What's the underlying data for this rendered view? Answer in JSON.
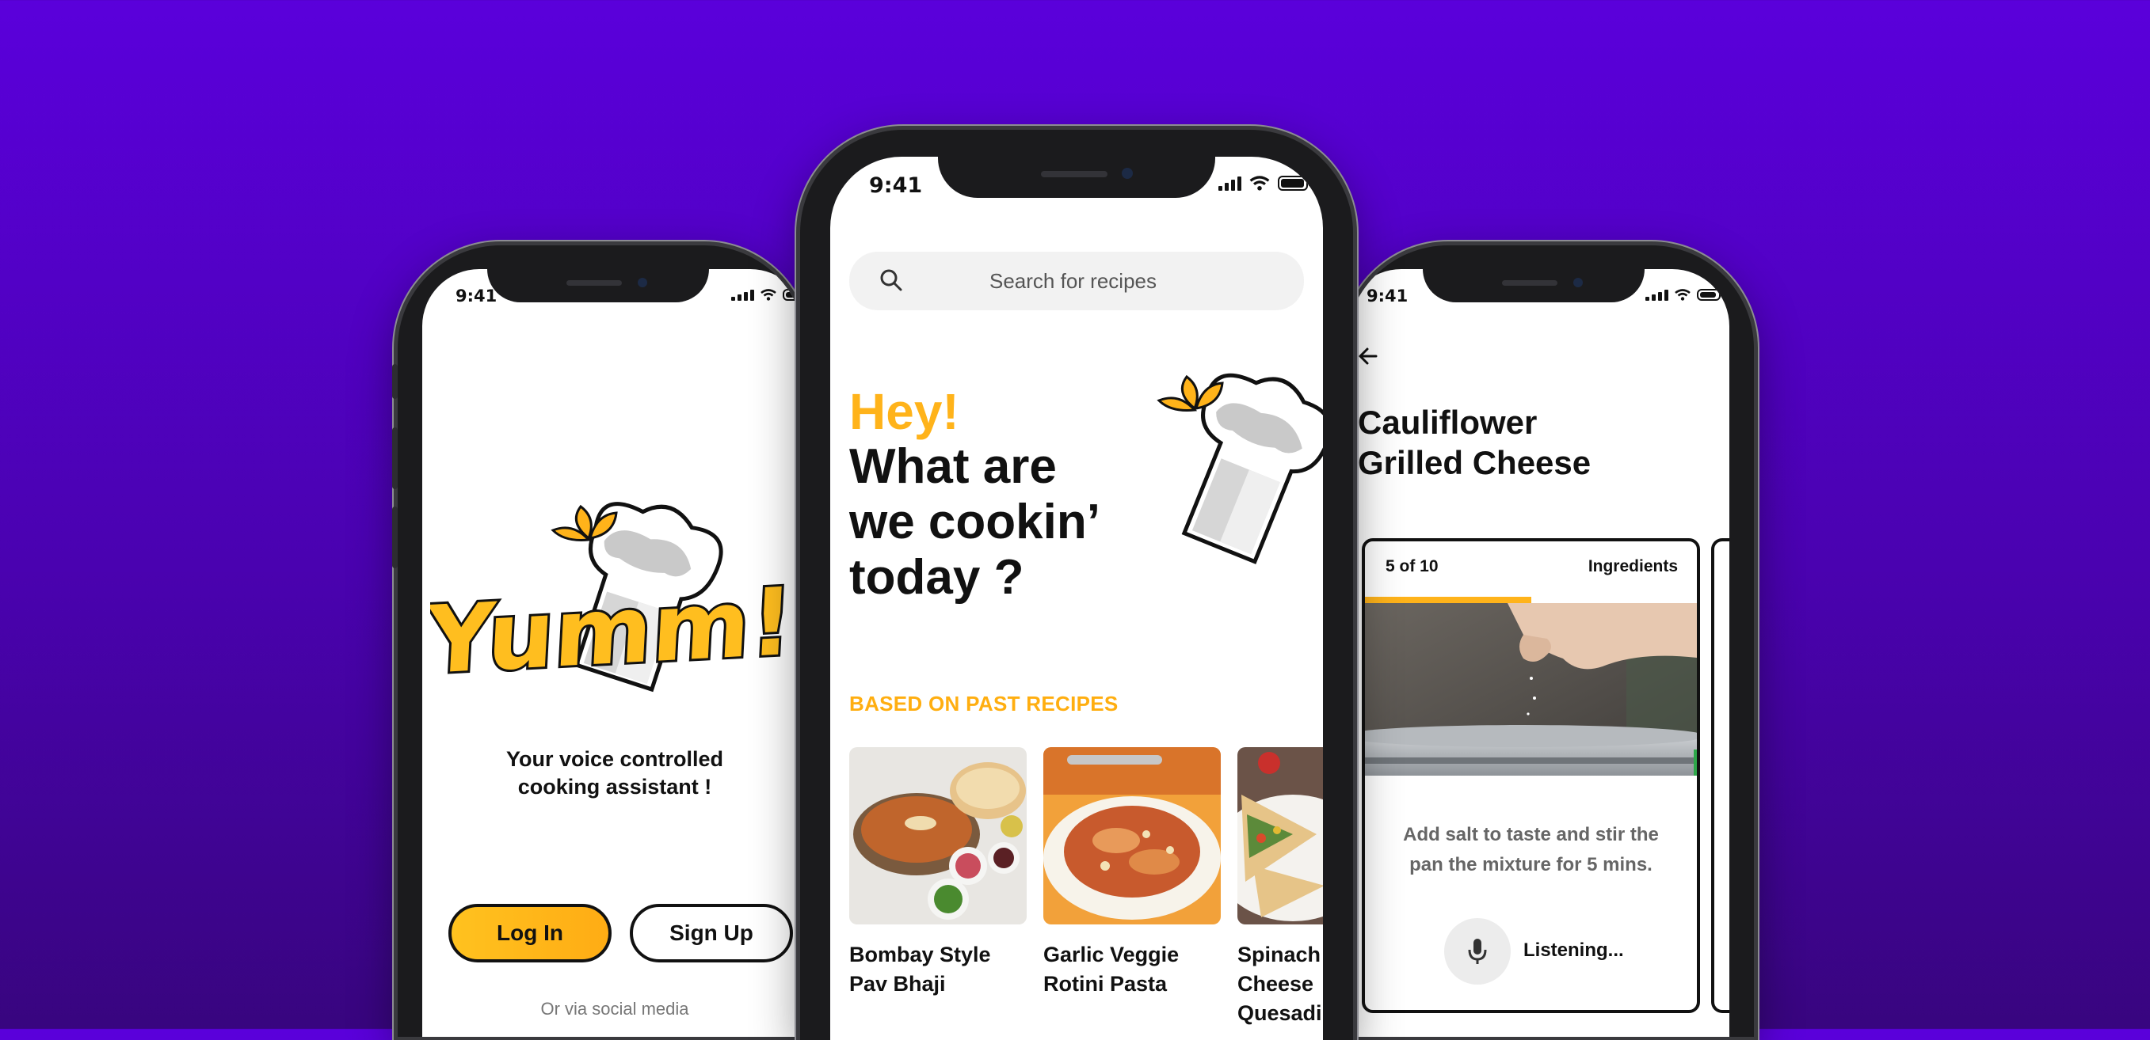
{
  "status_time": "9:41",
  "left_screen": {
    "logo_text": "Yumm!",
    "tagline_line1": "Your voice controlled",
    "tagline_line2": "cooking assistant !",
    "login_label": "Log In",
    "signup_label": "Sign Up",
    "social_text": "Or via social media"
  },
  "center_screen": {
    "search_placeholder": "Search for recipes",
    "greeting": "Hey!",
    "headline_line1": "What are",
    "headline_line2": "we cookin’",
    "headline_line3": "today ?",
    "section_title": "BASED ON PAST RECIPES",
    "recipes": [
      {
        "line1": "Bombay Style",
        "line2": "Pav Bhaji",
        "line3": ""
      },
      {
        "line1": "Garlic Veggie",
        "line2": "Rotini Pasta",
        "line3": ""
      },
      {
        "line1": "Spinach &",
        "line2": "Cheese",
        "line3": "Quesadilla"
      }
    ]
  },
  "right_screen": {
    "title_line1": "Cauliflower",
    "title_line2": "Grilled Cheese",
    "step_counter": "5 of 10",
    "ingredients_label": "Ingredients",
    "progress": 0.5,
    "instruction_line1": "Add salt to taste and stir the",
    "instruction_line2": "pan the mixture for 5 mins.",
    "listening_label": "Listening..."
  },
  "colors": {
    "accent_yellow": "#ffb31a",
    "background_top": "#5a00db",
    "background_bottom": "#38057f"
  },
  "icons": [
    "search-icon",
    "back-arrow-icon",
    "mic-icon",
    "chef-hat-icon",
    "signal-icon",
    "wifi-icon",
    "battery-icon"
  ]
}
